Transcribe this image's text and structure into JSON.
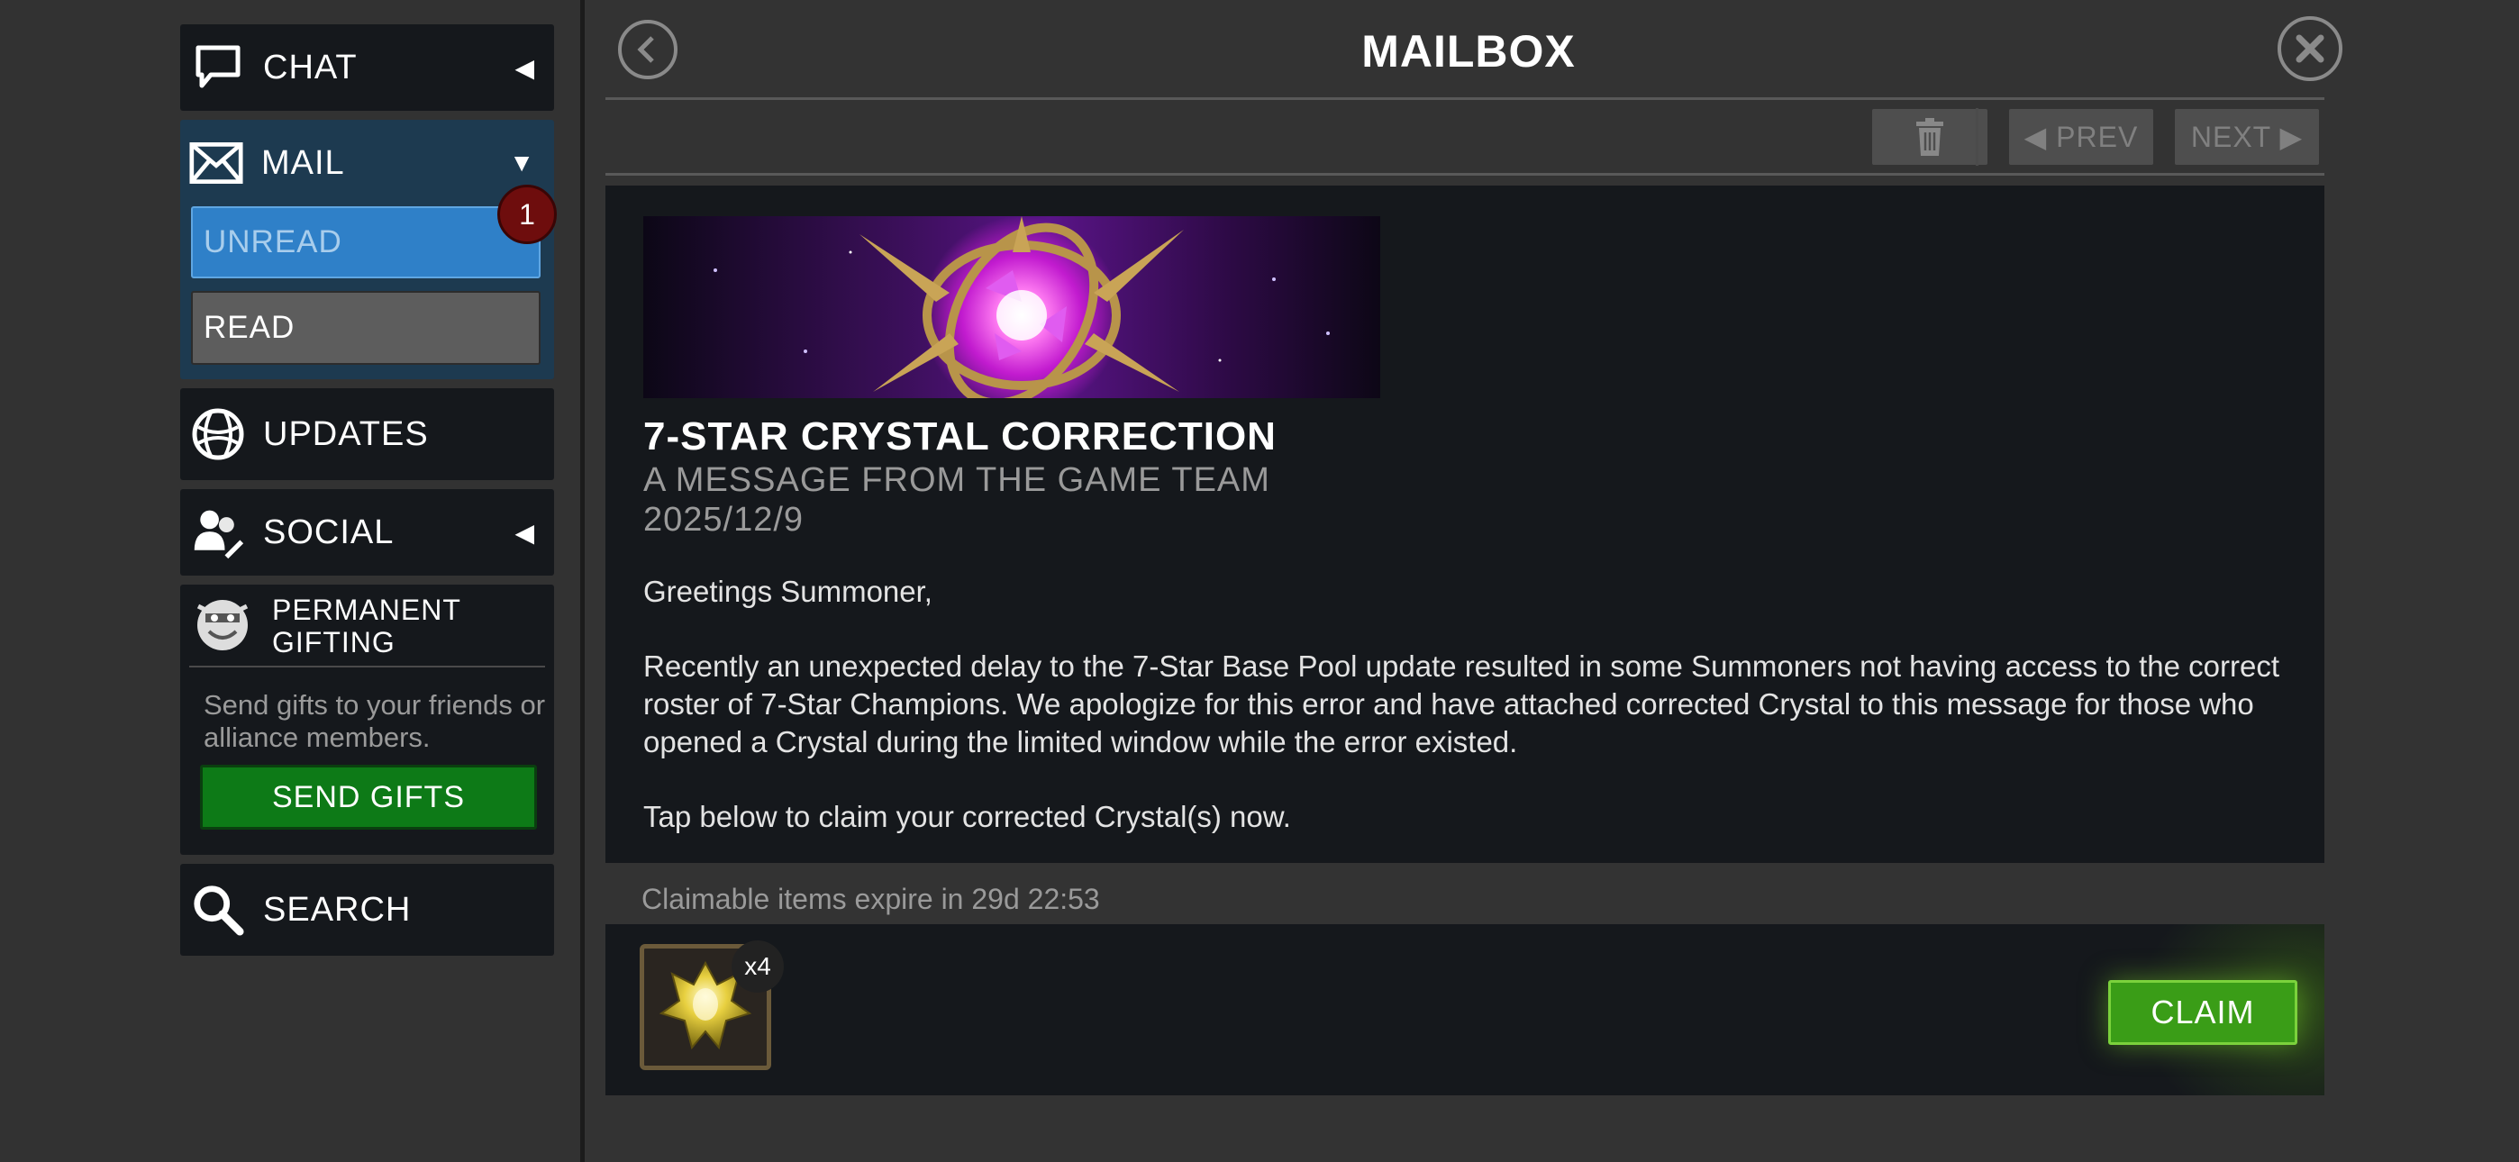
{
  "sidebar": {
    "chat_label": "CHAT",
    "mail_label": "MAIL",
    "unread_label": "UNREAD",
    "unread_count": "1",
    "read_label": "READ",
    "updates_label": "UPDATES",
    "social_label": "SOCIAL",
    "gifting_title": "PERMANENT GIFTING",
    "gifting_desc": "Send gifts to your friends or alliance members.",
    "send_gifts_label": "SEND GIFTS",
    "search_label": "SEARCH"
  },
  "header": {
    "title": "MAILBOX",
    "prev_label": "◀ PREV",
    "next_label": "NEXT ▶"
  },
  "message": {
    "title": "7-STAR CRYSTAL CORRECTION",
    "from": "A MESSAGE FROM THE GAME TEAM",
    "date": "2025/12/9",
    "body": [
      "Greetings Summoner,",
      "Recently an unexpected delay to the 7-Star Base Pool update resulted in some Summoners not having access to the correct roster of 7-Star Champions. We apologize for this error and have attached corrected Crystal to this message for those who opened a Crystal during the limited window while the error existed.",
      "Tap below to claim your corrected Crystal(s) now."
    ]
  },
  "rewards": {
    "expiry": "Claimable items expire in 29d 22:53",
    "item_quantity": "x4",
    "item_icon": "gold-crystal-icon",
    "claim_label": "CLAIM"
  },
  "colors": {
    "background": "#333333",
    "panel": "#15181c",
    "unread_tab": "#2f80c8",
    "badge": "#6e0d0d",
    "send_gifts": "#0d7a17",
    "claim": "#3a9d17"
  }
}
